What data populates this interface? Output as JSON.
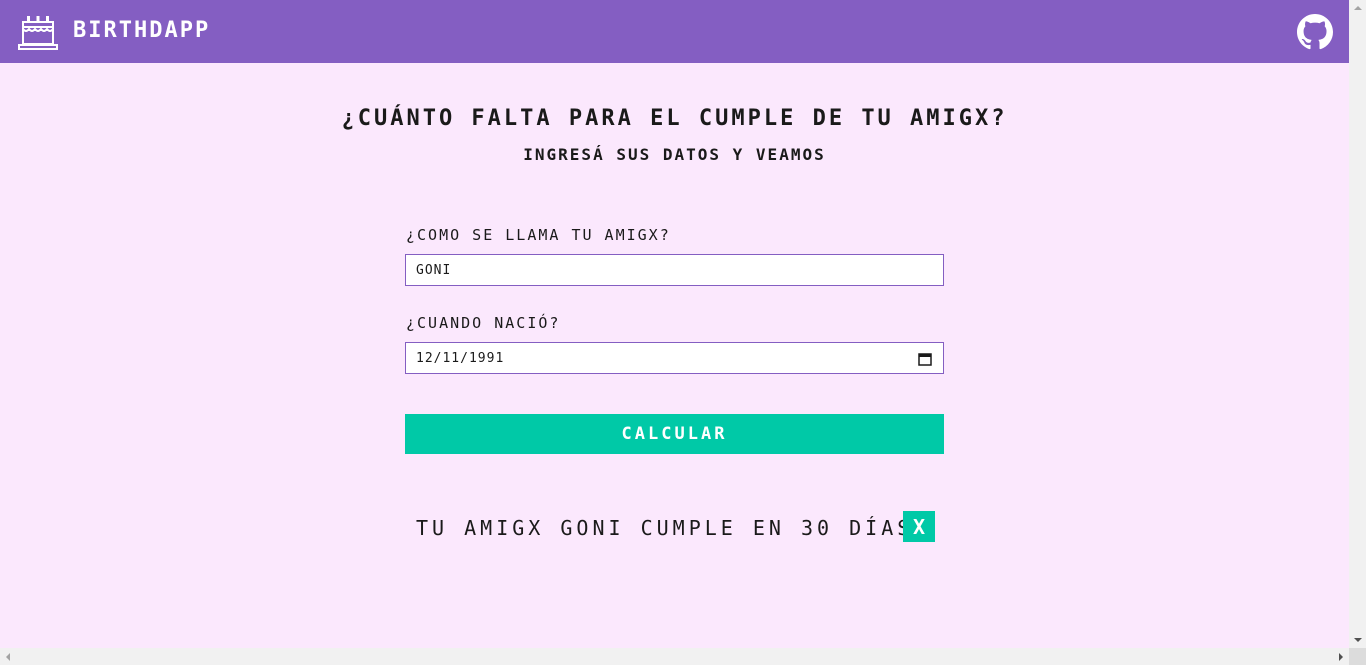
{
  "header": {
    "brand": "BIRTHDAPP",
    "logo_icon": "birthday-cake-icon",
    "github_icon": "github-icon",
    "background_color": "#845ec2"
  },
  "main": {
    "title": "¿CUÁNTO FALTA PARA EL CUMPLE DE TU AMIGX?",
    "subtitle": "INGRESÁ SUS DATOS Y VEAMOS"
  },
  "form": {
    "name_label": "¿COMO SE LLAMA TU AMIGX?",
    "name_value": "GONI",
    "birth_label": "¿CUANDO NACIÓ?",
    "birth_value": "12/11/1991",
    "calendar_icon": "calendar-icon",
    "submit_label": "CALCULAR"
  },
  "result": {
    "text": "TU AMIGX GONI CUMPLE EN 30 DÍAS",
    "close_label": "X"
  },
  "colors": {
    "page_background": "#fbe8fd",
    "accent": "#00c9a7",
    "primary": "#845ec2"
  }
}
